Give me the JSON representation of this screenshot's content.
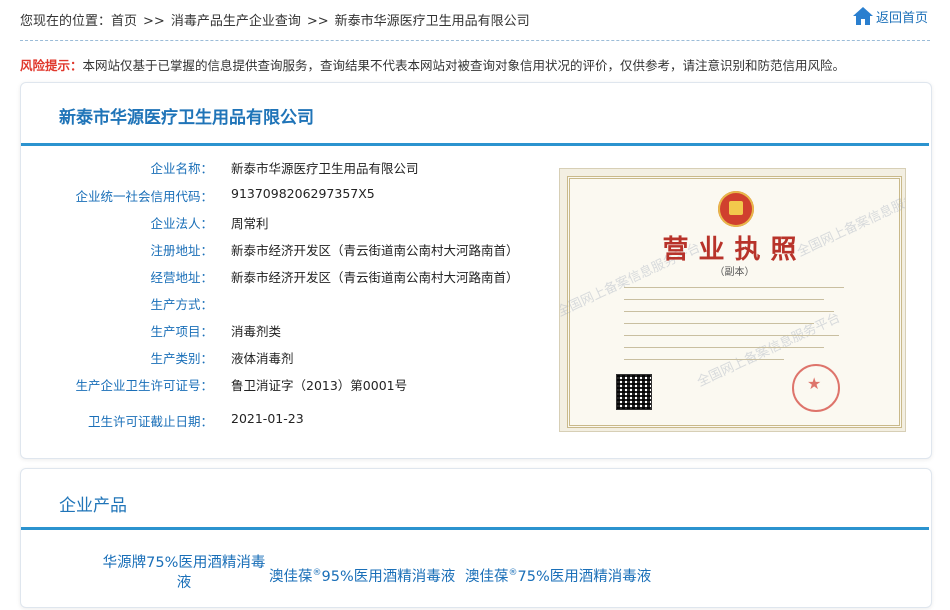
{
  "breadcrumb": {
    "prefix": "您现在的位置：",
    "items": [
      "首页",
      "消毒产品生产企业查询",
      "新泰市华源医疗卫生用品有限公司"
    ],
    "separator": ">>"
  },
  "back_home": {
    "label": "返回首页",
    "icon": "home-icon"
  },
  "risk_notice": {
    "label": "风险提示：",
    "text": "本网站仅基于已掌握的信息提供查询服务，查询结果不代表本网站对被查询对象信用状况的评价，仅供参考，请注意识别和防范信用风险。"
  },
  "company": {
    "title": "新泰市华源医疗卫生用品有限公司",
    "fields": [
      {
        "label": "企业名称：",
        "value": "新泰市华源医疗卫生用品有限公司"
      },
      {
        "label": "企业统一社会信用代码：",
        "value": "9137098206297357X5"
      },
      {
        "label": "企业法人：",
        "value": "周常利"
      },
      {
        "label": "注册地址：",
        "value": "新泰市经济开发区（青云街道南公南村大河路南首）"
      },
      {
        "label": "经营地址：",
        "value": "新泰市经济开发区（青云街道南公南村大河路南首）"
      },
      {
        "label": "生产方式：",
        "value": ""
      },
      {
        "label": "生产项目：",
        "value": "消毒剂类"
      },
      {
        "label": "生产类别：",
        "value": "液体消毒剂"
      },
      {
        "label": "生产企业卫生许可证号：",
        "value": "鲁卫消证字（2013）第0001号"
      },
      {
        "label": "卫生许可证截止日期：",
        "value": "2021-01-23"
      }
    ]
  },
  "license_image": {
    "title": "营业执照",
    "subtitle": "（副本）",
    "watermark": "全国网上备案信息服务平台"
  },
  "products_section": {
    "title": "企业产品",
    "items": [
      {
        "line1": "华源牌75%医用酒精消毒",
        "line2": "液"
      },
      {
        "pre": "澳佳葆",
        "mark": "®",
        "post": "95%医用酒精消毒液"
      },
      {
        "pre": "澳佳葆",
        "mark": "®",
        "post": "75%医用酒精消毒液"
      }
    ]
  },
  "colors": {
    "accent": "#1f74b8",
    "rule": "#2b93cf",
    "risk": "#e0382d"
  }
}
